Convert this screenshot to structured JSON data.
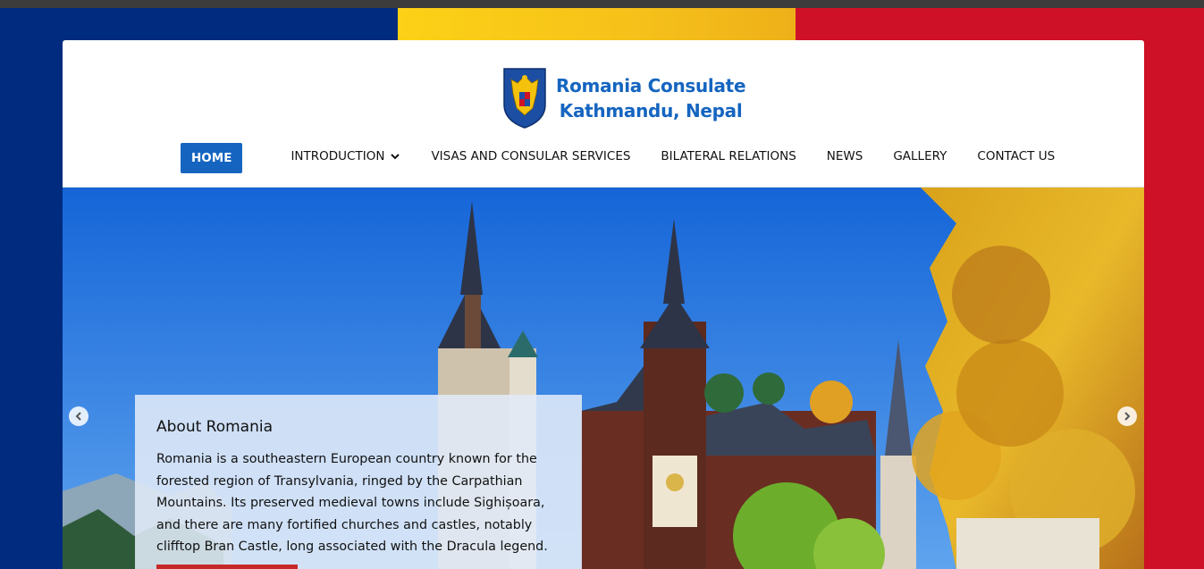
{
  "site": {
    "title_line1": "Romania Consulate",
    "title_line2": "Kathmandu, Nepal",
    "crest_icon": "romanian-coat-of-arms"
  },
  "nav": {
    "items": [
      {
        "label": "HOME",
        "active": true
      },
      {
        "label": "INTRODUCTION",
        "has_dropdown": true
      },
      {
        "label": "VISAS AND CONSULAR SERVICES"
      },
      {
        "label": "BILATERAL RELATIONS"
      },
      {
        "label": "NEWS"
      },
      {
        "label": "GALLERY"
      },
      {
        "label": "CONTACT US"
      }
    ]
  },
  "hero": {
    "caption_title": "About Romania",
    "caption_text": "Romania is a southeastern European country known for the forested region of Transylvania, ringed by the Carpathian Mountains. Its preserved medieval towns include Sighișoara, and there are many fortified churches and castles, notably clifftop Bran Castle, long associated with the Dracula legend.",
    "prev_icon": "chevron-left-icon",
    "next_icon": "chevron-right-icon"
  },
  "colors": {
    "flag_blue": "#002b7f",
    "flag_yellow": "#fcd116",
    "flag_red": "#ce1126",
    "accent": "#1565c0"
  }
}
